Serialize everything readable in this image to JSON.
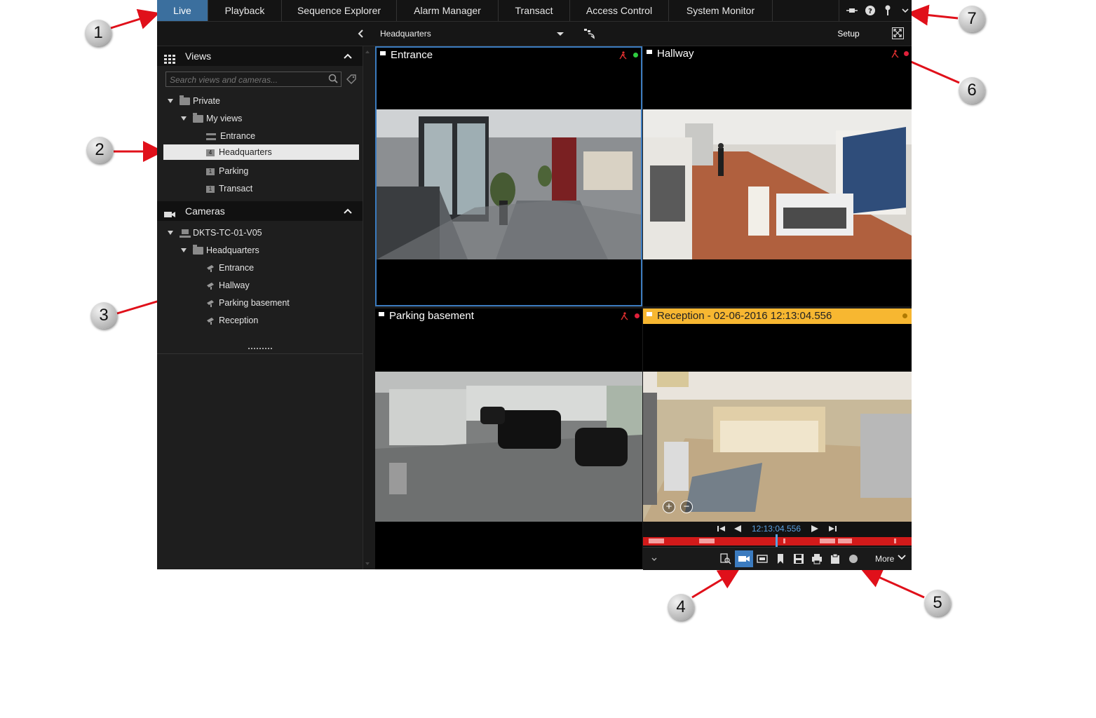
{
  "tabs": [
    "Live",
    "Playback",
    "Sequence Explorer",
    "Alarm Manager",
    "Transact",
    "Access Control",
    "System Monitor"
  ],
  "active_tab": "Live",
  "toolbar": {
    "view_selected": "Headquarters",
    "setup_label": "Setup"
  },
  "views_panel": {
    "title": "Views",
    "search_placeholder": "Search views and cameras...",
    "tree": {
      "private": "Private",
      "my_views": "My views",
      "items": [
        {
          "label": "Entrance",
          "badge": ""
        },
        {
          "label": "Headquarters",
          "badge": "4"
        },
        {
          "label": "Parking",
          "badge": "1"
        },
        {
          "label": "Transact",
          "badge": "1"
        }
      ]
    }
  },
  "cameras_panel": {
    "title": "Cameras",
    "server": "DKTS-TC-01-V05",
    "group": "Headquarters",
    "cameras": [
      "Entrance",
      "Hallway",
      "Parking basement",
      "Reception"
    ]
  },
  "tiles": [
    {
      "title": "Entrance",
      "status": "#2ecc40"
    },
    {
      "title": "Hallway",
      "status": "#e0203a"
    },
    {
      "title": "Parking basement",
      "status": "#e0203a"
    },
    {
      "title": "Reception - 02-06-2016 12:13:04.556",
      "status": "#b07a00"
    }
  ],
  "playback": {
    "time": "12:13:04.556",
    "more_label": "More"
  },
  "callouts": [
    "1",
    "2",
    "3",
    "4",
    "5",
    "6",
    "7"
  ],
  "colors": {
    "accent_tab": "#3b6f9e",
    "playback_highlight": "#f7b731",
    "timeline": "#d21a1a",
    "arrow": "#e0101a"
  }
}
